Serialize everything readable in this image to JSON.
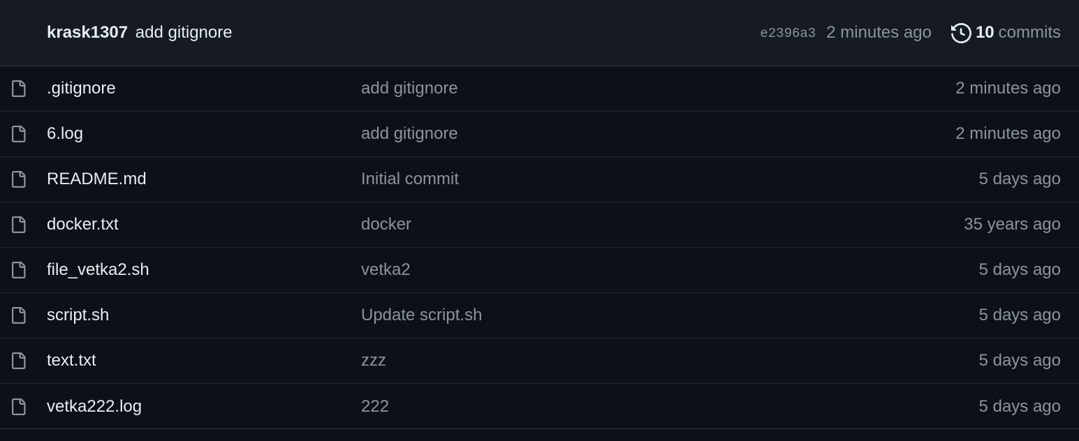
{
  "commit": {
    "author": "krask1307",
    "message": "add gitignore",
    "sha": "e2396a3",
    "time": "2 minutes ago",
    "commits_count": "10",
    "commits_label": "commits",
    "history_icon": "history-icon"
  },
  "files": [
    {
      "name": ".gitignore",
      "commit": "add gitignore",
      "time": "2 minutes ago",
      "icon": "file-icon"
    },
    {
      "name": "6.log",
      "commit": "add gitignore",
      "time": "2 minutes ago",
      "icon": "file-icon"
    },
    {
      "name": "README.md",
      "commit": "Initial commit",
      "time": "5 days ago",
      "icon": "file-icon"
    },
    {
      "name": "docker.txt",
      "commit": "docker",
      "time": "35 years ago",
      "icon": "file-icon"
    },
    {
      "name": "file_vetka2.sh",
      "commit": "vetka2",
      "time": "5 days ago",
      "icon": "file-icon"
    },
    {
      "name": "script.sh",
      "commit": "Update script.sh",
      "time": "5 days ago",
      "icon": "file-icon"
    },
    {
      "name": "text.txt",
      "commit": "zzz",
      "time": "5 days ago",
      "icon": "file-icon"
    },
    {
      "name": "vetka222.log",
      "commit": "222",
      "time": "5 days ago",
      "icon": "file-icon"
    }
  ],
  "colors": {
    "background": "#0d1117",
    "header_background": "#161b22",
    "border": "#30363d",
    "text_primary": "#e6edf3",
    "text_muted": "#8b949e"
  }
}
